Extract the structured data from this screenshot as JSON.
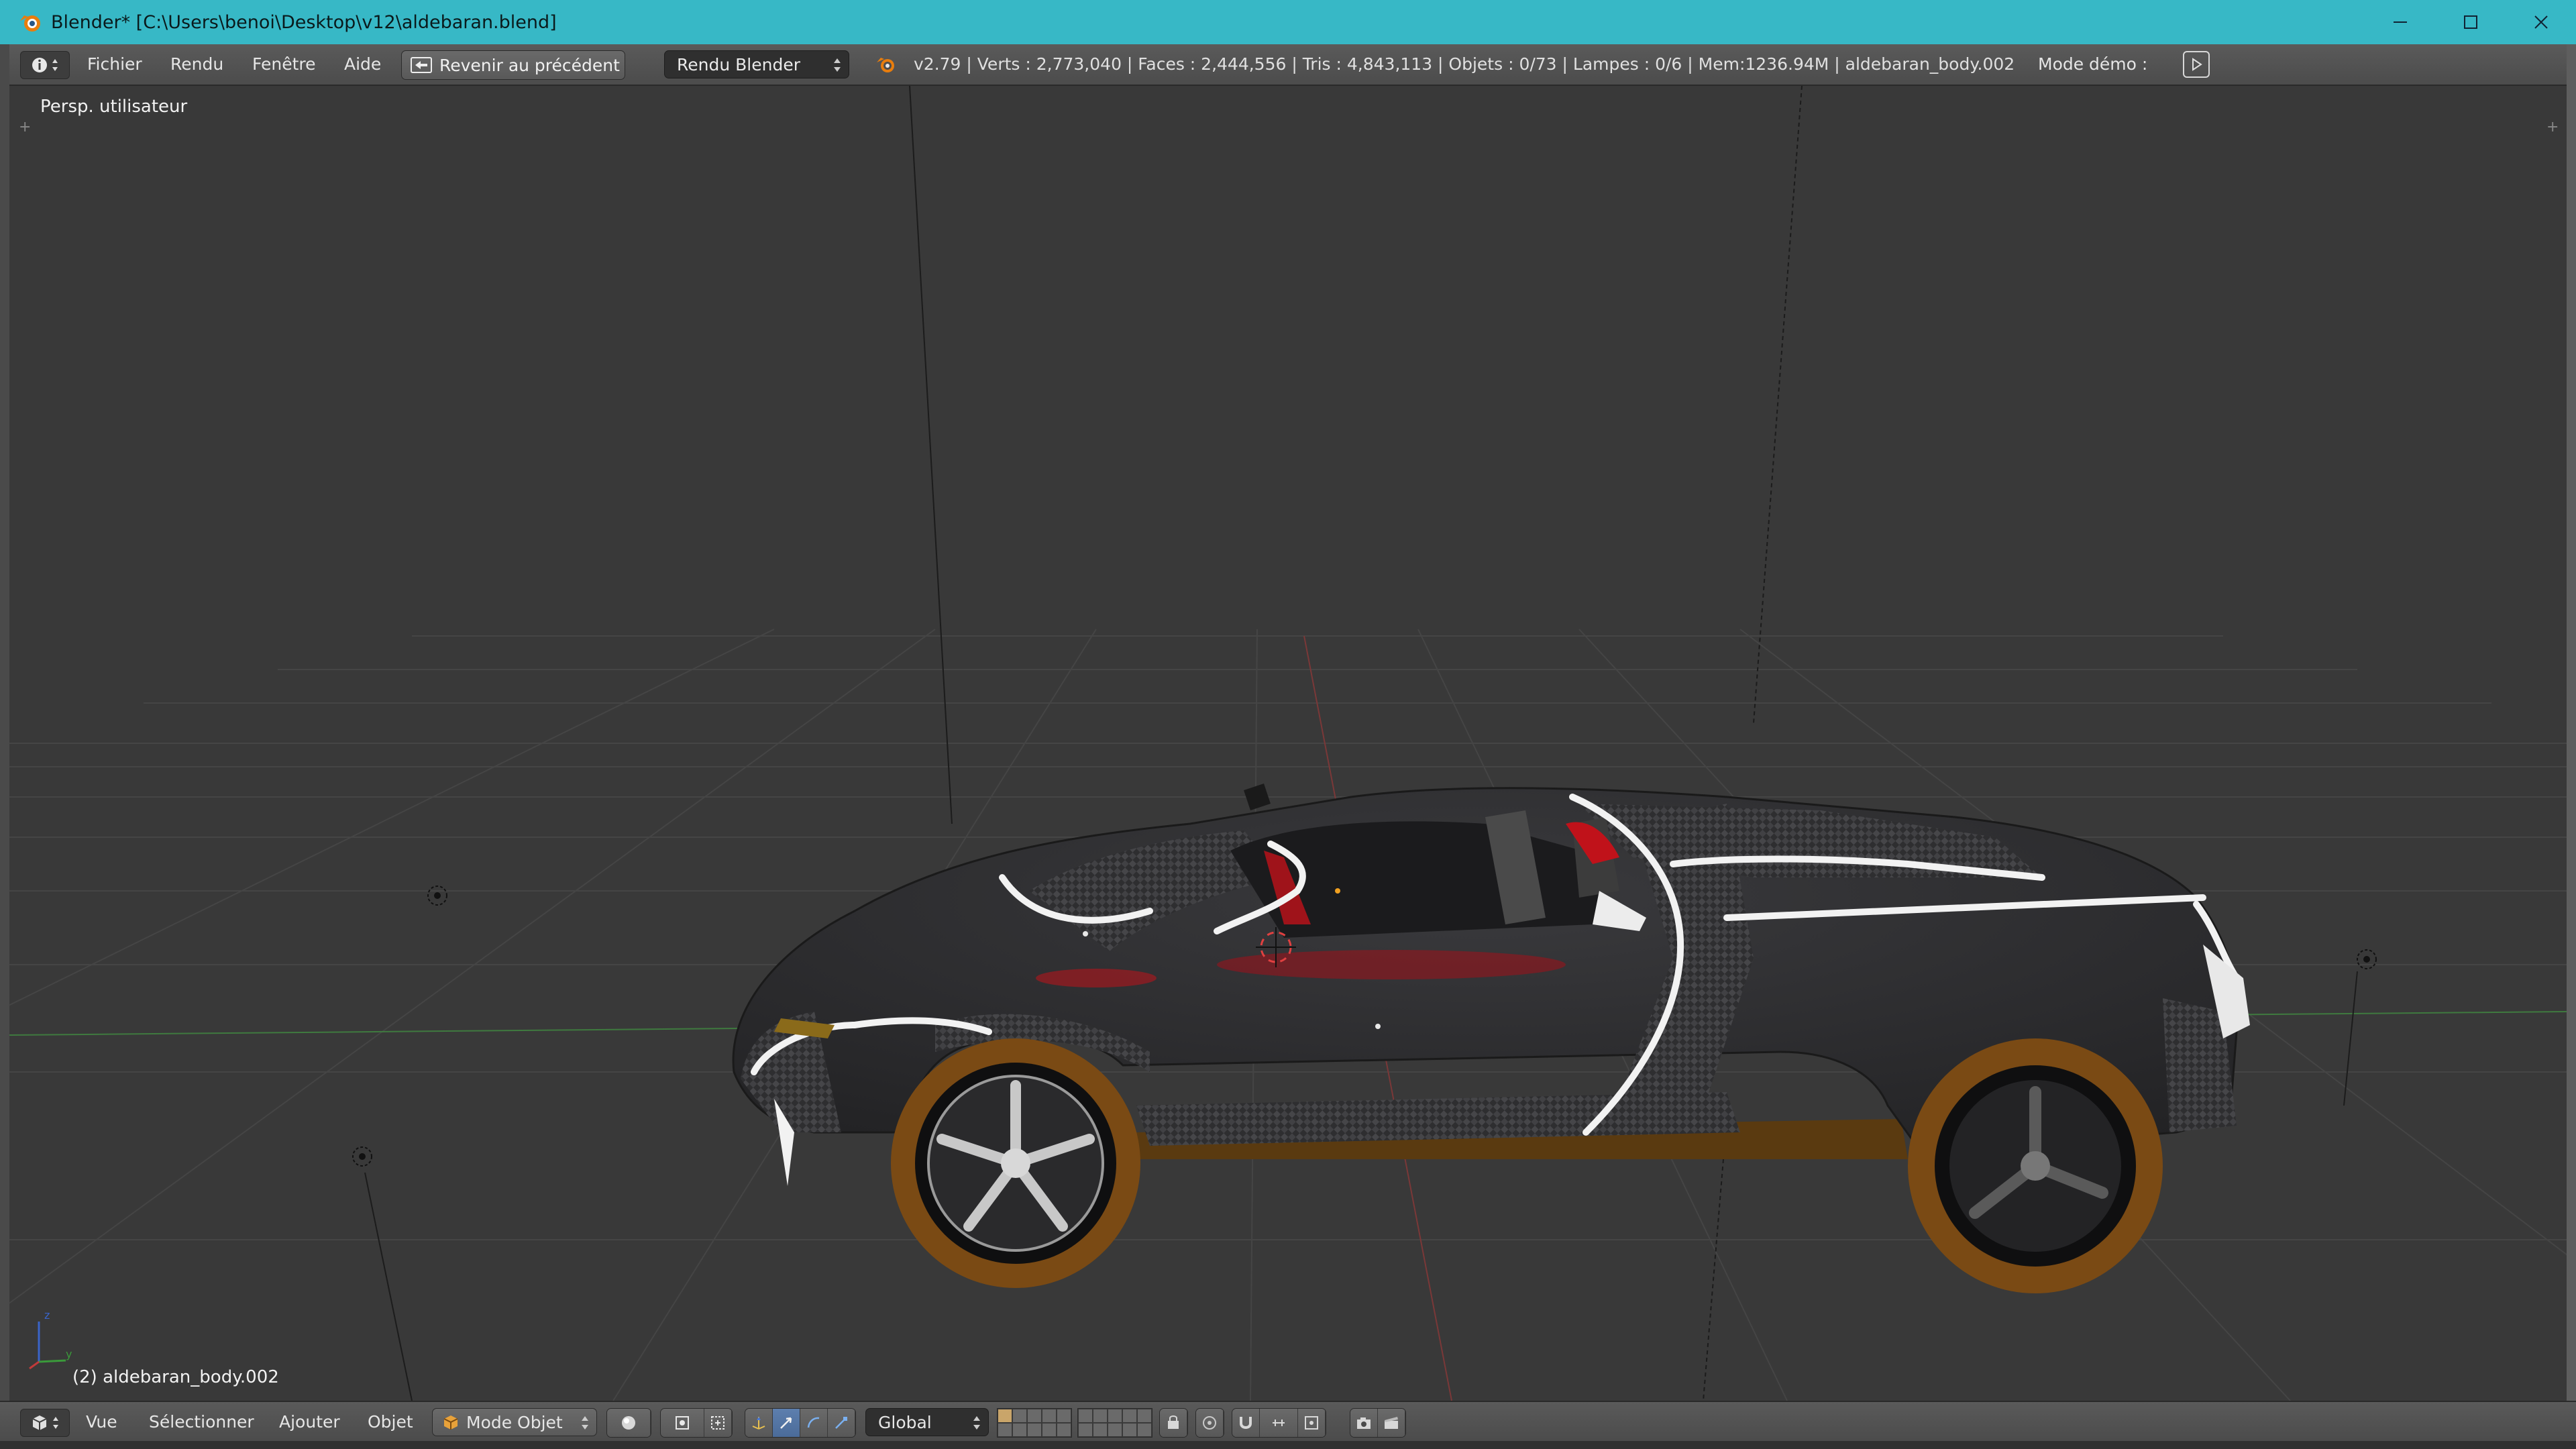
{
  "window": {
    "title": "Blender* [C:\\Users\\benoi\\Desktop\\v12\\aldebaran.blend]",
    "controls": [
      "minimize-icon",
      "maximize-icon",
      "close-icon"
    ]
  },
  "info_header": {
    "editor_icon": "info-icon",
    "menus": [
      "Fichier",
      "Rendu",
      "Fenêtre",
      "Aide"
    ],
    "revert_button": "Revenir au précédent",
    "render_engine": "Rendu Blender",
    "stats": "v2.79 | Verts  : 2,773,040 | Faces  : 2,444,556 | Tris  : 4,843,113 | Objets  : 0/73 | Lampes  : 0/6 | Mem:1236.94M | aldebaran_body.002",
    "mode_demo": "Mode démo  :",
    "play_icon": "play-icon"
  },
  "viewport": {
    "view_label": "Persp. utilisateur",
    "active_object_label": "(2) aldebaran_body.002"
  },
  "view_header": {
    "editor_icon": "3d-view-icon",
    "menus": [
      "Vue",
      "Sélectionner",
      "Ajouter",
      "Objet"
    ],
    "interaction_mode": "Mode Objet",
    "shading_icon": "solid-shading-icon",
    "pivot_icon": "pivot-icon",
    "transform_orientation": "Global",
    "snap_icon": "magnet-icon"
  },
  "colors": {
    "titlebar": "#37b8c6",
    "header": "#545454",
    "viewport": "#393939",
    "car_body": "#2a2a2c",
    "tire": "#7a4a14",
    "accent_red": "#c0121a",
    "active_tool": "#5577a6"
  }
}
